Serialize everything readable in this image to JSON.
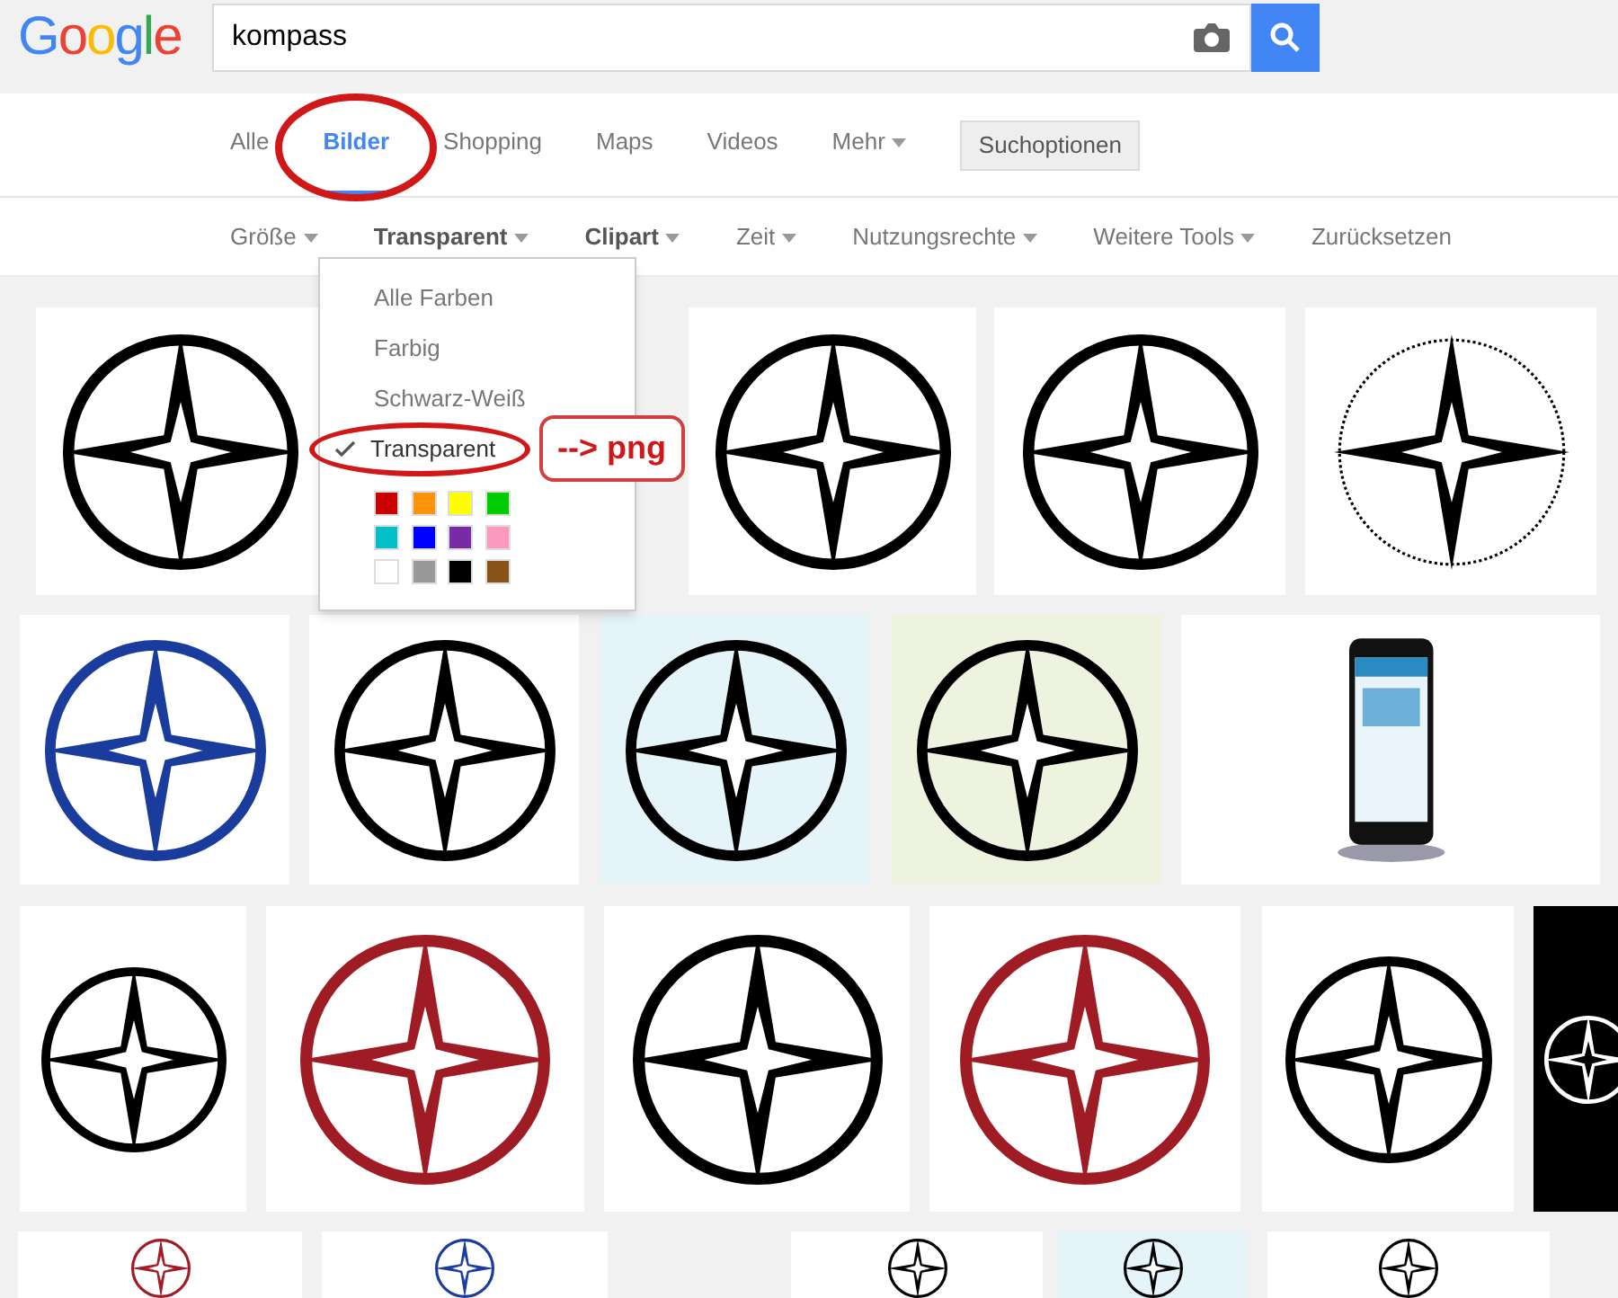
{
  "logo": "Google",
  "search": {
    "value": "kompass"
  },
  "tabs": [
    {
      "label": "Alle",
      "selected": false
    },
    {
      "label": "Bilder",
      "selected": true
    },
    {
      "label": "Shopping",
      "selected": false
    },
    {
      "label": "Maps",
      "selected": false
    },
    {
      "label": "Videos",
      "selected": false
    },
    {
      "label": "Mehr",
      "selected": false,
      "kind": "menu"
    }
  ],
  "options_button": "Suchoptionen",
  "tools": [
    {
      "label": "Größe",
      "active": false,
      "kind": "menu"
    },
    {
      "label": "Transparent",
      "active": true,
      "kind": "menu"
    },
    {
      "label": "Clipart",
      "active": true,
      "kind": "menu"
    },
    {
      "label": "Zeit",
      "active": false,
      "kind": "menu"
    },
    {
      "label": "Nutzungsrechte",
      "active": false,
      "kind": "menu"
    },
    {
      "label": "Weitere Tools",
      "active": false,
      "kind": "menu"
    },
    {
      "label": "Zurücksetzen",
      "active": false,
      "kind": "link"
    }
  ],
  "color_menu": {
    "items": [
      {
        "label": "Alle Farben",
        "selected": false
      },
      {
        "label": "Farbig",
        "selected": false
      },
      {
        "label": "Schwarz-Weiß",
        "selected": false
      },
      {
        "label": "Transparent",
        "selected": true
      }
    ],
    "swatches": [
      {
        "color": "#cc0000"
      },
      {
        "color": "#fb940b"
      },
      {
        "color": "#ffff00"
      },
      {
        "color": "#00cc00"
      },
      {
        "color": "#03c0c6"
      },
      {
        "color": "#0000ff"
      },
      {
        "color": "#762ca7"
      },
      {
        "color": "#ff98bf"
      },
      {
        "color": "#ffffff"
      },
      {
        "color": "#999999"
      },
      {
        "color": "#000000"
      },
      {
        "color": "#885418"
      }
    ]
  },
  "annotation": {
    "callout": "--> png"
  }
}
